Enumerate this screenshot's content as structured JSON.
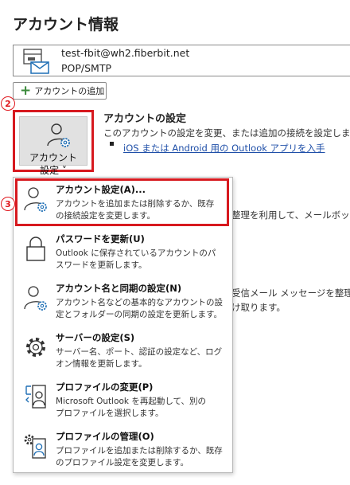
{
  "page": {
    "title": "アカウント情報"
  },
  "account": {
    "email": "test-fbit@wh2.fiberbit.net",
    "type": "POP/SMTP"
  },
  "add_account": {
    "label": "アカウントの追加"
  },
  "steps": {
    "step2": "2",
    "step3": "3"
  },
  "settings_button": {
    "line1": "アカウント",
    "line2": "設定 ˅"
  },
  "section": {
    "title": "アカウントの設定",
    "description": "このアカウントの設定を変更、または追加の接続を設定します。",
    "link": "iOS または Android 用の Outlook アプリを入手"
  },
  "background_text": {
    "line1": "整理を利用して、メールボックス",
    "line2": "受信メール メッセージを整理し",
    "line3": "け取ります。"
  },
  "menu": {
    "items": [
      {
        "title": "アカウント設定(A)...",
        "desc1": "アカウントを追加または削除するか、既存",
        "desc2": "の接続設定を変更します。",
        "icon": "account-gear-icon"
      },
      {
        "title": "パスワードを更新(U)",
        "desc1": "Outlook に保存されているアカウントのパ",
        "desc2": "スワードを更新します。",
        "icon": "lock-icon"
      },
      {
        "title": "アカウント名と同期の設定(N)",
        "desc1": "アカウント名などの基本的なアカウントの設",
        "desc2": "定とフォルダーの同期の設定を更新します。",
        "icon": "account-gear-icon"
      },
      {
        "title": "サーバーの設定(S)",
        "desc1": "サーバー名、ポート、認証の設定など、ログ",
        "desc2": "オン情報を更新します。",
        "icon": "gear-icon"
      },
      {
        "title": "プロファイルの変更(P)",
        "desc1": "Microsoft Outlook を再起動して、別の",
        "desc2": "プロファイルを選択します。",
        "icon": "profile-switch-icon"
      },
      {
        "title": "プロファイルの管理(O)",
        "desc1": "プロファイルを追加または削除するか、既存",
        "desc2": "のプロファイル設定を変更します。",
        "icon": "profile-manage-icon"
      }
    ]
  },
  "colors": {
    "highlight": "#d7191f",
    "link": "#1f4fa8",
    "accent": "#1f6fb5"
  }
}
